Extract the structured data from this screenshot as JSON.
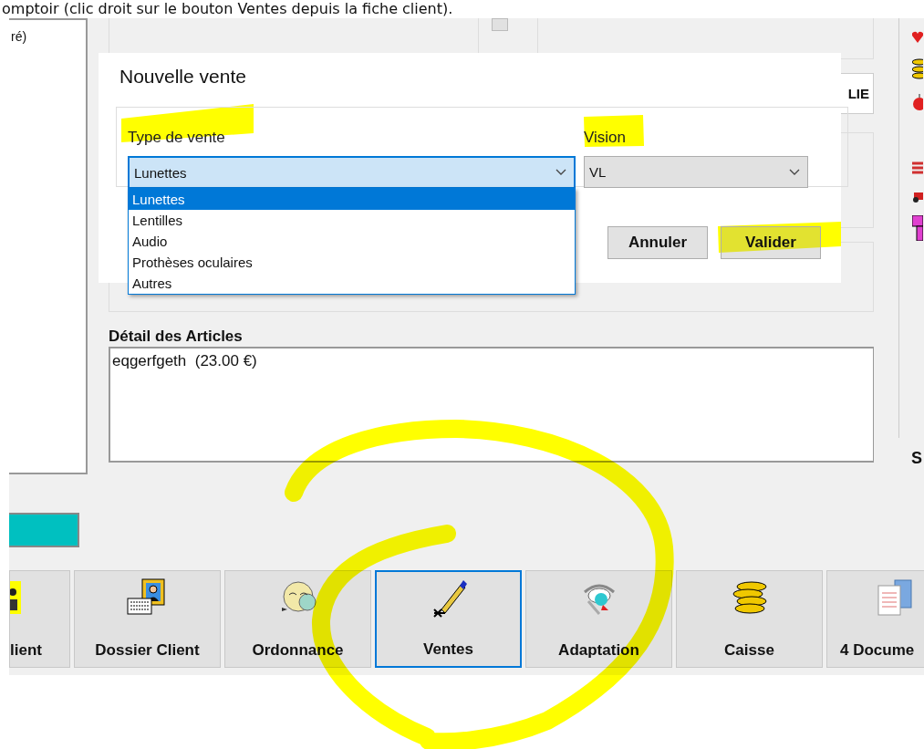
{
  "document_text": "omptoir (clic droit sur le bouton Ventes depuis la fiche client).",
  "client_list": {
    "items": [
      "ré)"
    ]
  },
  "side_button": "LIE",
  "dialog": {
    "title": "Nouvelle vente",
    "fields": [
      {
        "label": "Type de vente",
        "value": "Lunettes",
        "focused": true,
        "open": true,
        "options": [
          {
            "label": "Lunettes",
            "selected": true
          },
          {
            "label": "Lentilles",
            "selected": false
          },
          {
            "label": "Audio",
            "selected": false
          },
          {
            "label": "Prothèses oculaires",
            "selected": false
          },
          {
            "label": "Autres",
            "selected": false
          }
        ]
      },
      {
        "label": "Vision",
        "value": "VL",
        "focused": false,
        "open": false
      }
    ],
    "buttons": [
      "Annuler",
      "Valider"
    ]
  },
  "articles": {
    "title": "Détail des Articles",
    "lines": [
      "eqgerfgeth  (23.00 €)"
    ]
  },
  "side_group_label": "S",
  "toolbar": [
    {
      "label": "lient",
      "selected": false
    },
    {
      "label": "Dossier Client",
      "selected": false
    },
    {
      "label": "Ordonnance",
      "selected": false
    },
    {
      "label": "Ventes",
      "selected": true
    },
    {
      "label": "Adaptation",
      "selected": false
    },
    {
      "label": "Caisse",
      "selected": false
    },
    {
      "label": "4 Docume",
      "selected": false
    }
  ]
}
